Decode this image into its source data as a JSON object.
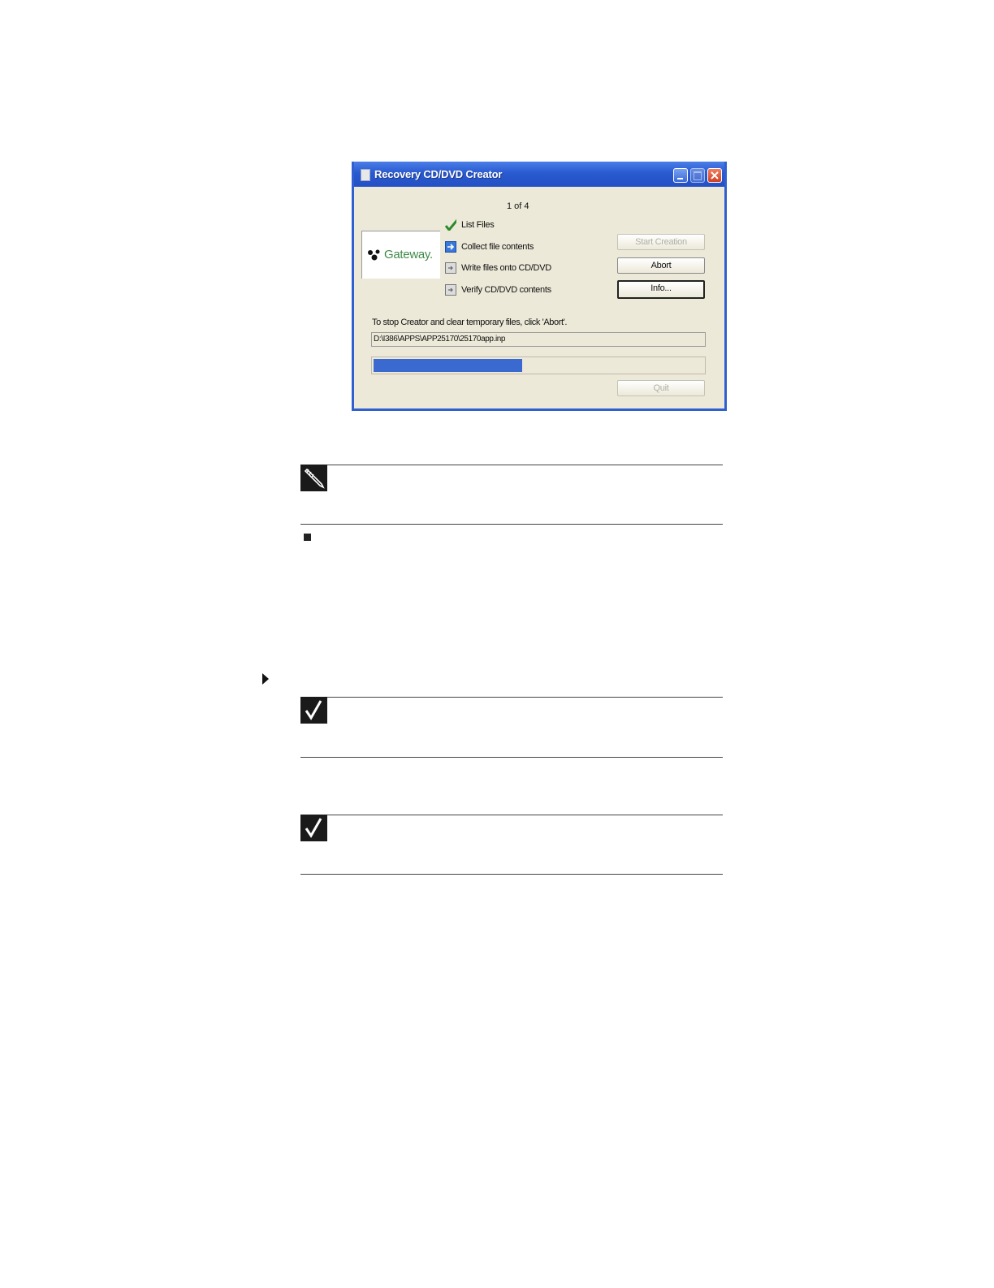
{
  "dialog": {
    "title": "Recovery CD/DVD Creator",
    "step_counter": "1 of 4",
    "logo_text": "Gateway.",
    "steps": [
      {
        "label": "List Files",
        "state": "done",
        "icon": "checkmark-icon"
      },
      {
        "label": "Collect file contents",
        "state": "current",
        "icon": "arrow-right-icon"
      },
      {
        "label": "Write files onto CD/DVD",
        "state": "pending",
        "icon": "pending-step-icon"
      },
      {
        "label": "Verify CD/DVD contents",
        "state": "pending",
        "icon": "pending-step-icon"
      }
    ],
    "buttons": {
      "start_creation": "Start Creation",
      "abort": "Abort",
      "info": "Info...",
      "quit": "Quit"
    },
    "hint": "To stop Creator and clear temporary files, click 'Abort'.",
    "current_file": "D:\\I386\\APPS\\APP25170\\25170app.inp",
    "progress_fraction": 0.45,
    "colors": {
      "title_bar": "#2a5ad0",
      "client_bg": "#ece9d8",
      "progress": "#3a6ad0",
      "logo_green": "#3f8a4a",
      "check_green": "#2a8a2a",
      "close_red": "#d04020"
    }
  },
  "document": {
    "icons": [
      "pencil-note-icon",
      "checkmark-note-icon",
      "checkmark-note-icon",
      "square-bullet-icon",
      "triangle-arrow-icon"
    ]
  }
}
